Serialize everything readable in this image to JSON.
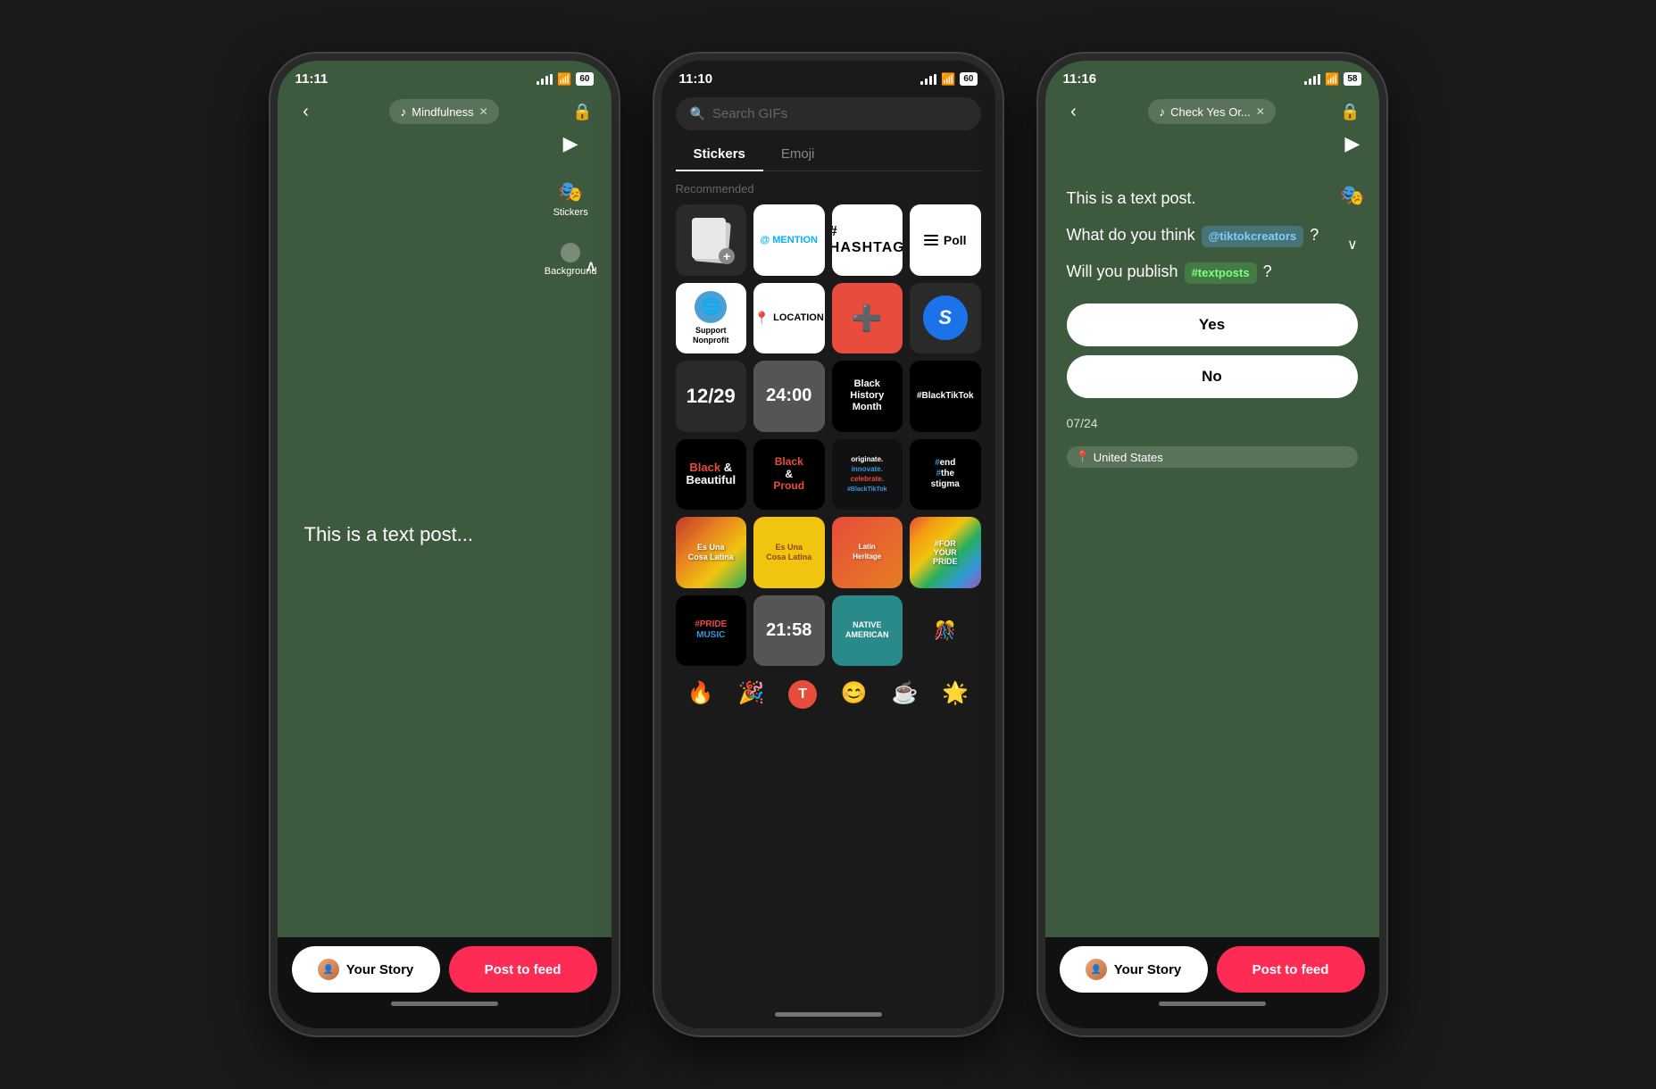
{
  "phones": [
    {
      "id": "phone1",
      "status": {
        "time": "11:11",
        "battery": "60"
      },
      "music_tag": "Mindfulness",
      "stickers_label": "Stickers",
      "background_label": "Background",
      "text_content": "This is a text post...",
      "bottom": {
        "your_story": "Your Story",
        "post_feed": "Post to feed"
      }
    },
    {
      "id": "phone2",
      "status": {
        "time": "11:10",
        "battery": "60"
      },
      "search_placeholder": "Search GIFs",
      "tabs": [
        "Stickers",
        "Emoji"
      ],
      "active_tab": "Stickers",
      "section_label": "Recommended",
      "stickers": [
        {
          "id": "add",
          "label": "Add"
        },
        {
          "id": "mention",
          "label": "@MENTION"
        },
        {
          "id": "hashtag",
          "label": "#HASHTAG"
        },
        {
          "id": "poll",
          "label": "Poll"
        },
        {
          "id": "support",
          "label": "Support Nonprofit"
        },
        {
          "id": "location",
          "label": "LOCATION"
        },
        {
          "id": "medical",
          "label": "Medical"
        },
        {
          "id": "shazam",
          "label": "Shazam"
        },
        {
          "id": "date",
          "label": "12/29"
        },
        {
          "id": "time",
          "label": "24:00"
        },
        {
          "id": "bhm",
          "label": "Black History Month"
        },
        {
          "id": "blacktiktok",
          "label": "#BlackTikTok"
        },
        {
          "id": "bnb",
          "label": "Black & Beautiful"
        },
        {
          "id": "bp",
          "label": "Black & Proud"
        },
        {
          "id": "originate",
          "label": "originate. innovate. celebrate."
        },
        {
          "id": "endthestigma",
          "label": "#end the stigma"
        },
        {
          "id": "cosa-latina",
          "label": "Es Una Cosa Latina"
        },
        {
          "id": "cosa-latina2",
          "label": "Es Una Cosa Latina Yellow"
        },
        {
          "id": "latin-heritage",
          "label": "Latin Heritage"
        },
        {
          "id": "foryourpride",
          "label": "#FORYOUR PRIDE"
        },
        {
          "id": "pride-music",
          "label": "#PRIDE MUSIC"
        },
        {
          "id": "time2",
          "label": "21:58"
        },
        {
          "id": "native",
          "label": "NATIVE AMERICAN"
        },
        {
          "id": "decorative",
          "label": "Decorative"
        },
        {
          "id": "fire",
          "label": "🔥"
        },
        {
          "id": "confetti",
          "label": "🎉"
        },
        {
          "id": "t-emoji",
          "label": "🅣"
        },
        {
          "id": "smile",
          "label": "😊"
        },
        {
          "id": "coffee",
          "label": "☕"
        },
        {
          "id": "sun",
          "label": "🌟"
        }
      ]
    },
    {
      "id": "phone3",
      "status": {
        "time": "11:16",
        "battery": "58"
      },
      "music_tag": "Check Yes Or...",
      "poll": {
        "line1": "This is a text post.",
        "line2_prefix": "What do you think ",
        "line2_tag": "@tiktokcreators",
        "line2_suffix": "?",
        "line3_prefix": "Will you publish ",
        "line3_tag": "#textposts",
        "line3_suffix": "?",
        "answer_yes": "Yes",
        "answer_no": "No",
        "date": "07/24",
        "location": "United States"
      },
      "bottom": {
        "your_story": "Your Story",
        "post_feed": "Post to feed"
      }
    }
  ]
}
